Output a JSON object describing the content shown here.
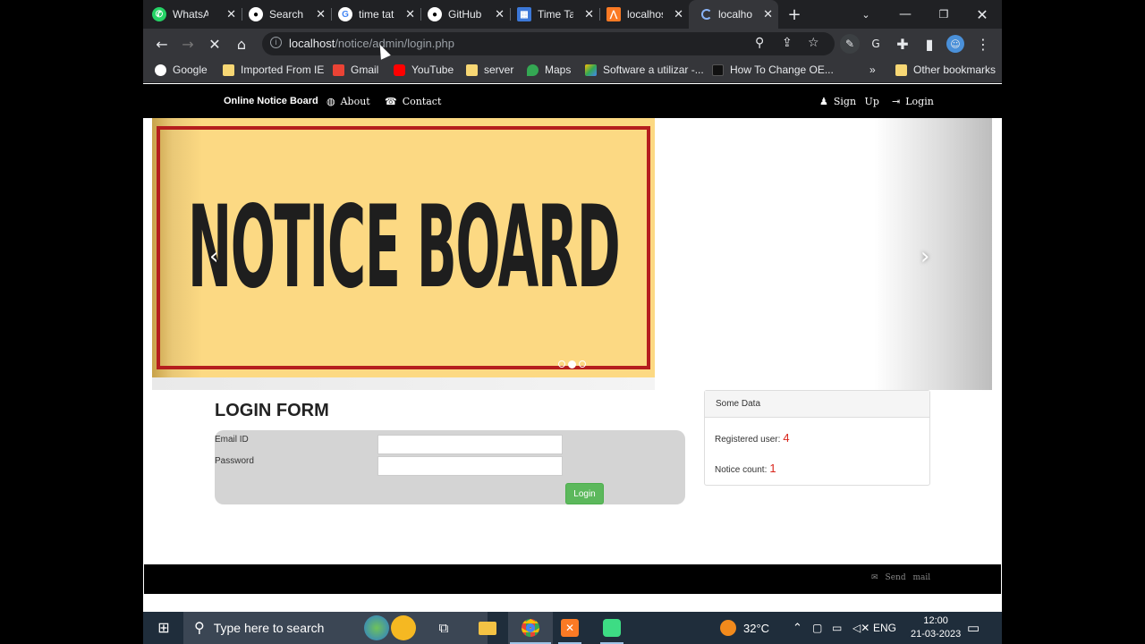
{
  "browser": {
    "tabs": [
      {
        "label": "WhatsA",
        "icon": "whatsapp-icon"
      },
      {
        "label": "Search ·",
        "icon": "github-icon"
      },
      {
        "label": "time tat",
        "icon": "google-icon"
      },
      {
        "label": "GitHub",
        "icon": "github-icon"
      },
      {
        "label": "Time Ta",
        "icon": "page-icon"
      },
      {
        "label": "localhos",
        "icon": "xampp-icon"
      },
      {
        "label": "localho",
        "icon": "loading-icon"
      }
    ],
    "url_host": "localhost",
    "url_path": "/notice/admin/login.php",
    "bookmarks": [
      {
        "label": "Google",
        "icon": "google-icon"
      },
      {
        "label": "Imported From IE",
        "icon": "folder-icon"
      },
      {
        "label": "Gmail",
        "icon": "gmail-icon"
      },
      {
        "label": "YouTube",
        "icon": "youtube-icon"
      },
      {
        "label": "server",
        "icon": "folder-icon"
      },
      {
        "label": "Maps",
        "icon": "maps-icon"
      },
      {
        "label": "Software a utilizar -...",
        "icon": "drive-icon"
      },
      {
        "label": "How To Change OE...",
        "icon": "page-icon"
      }
    ],
    "other_bookmarks": "Other bookmarks",
    "overflow": "»"
  },
  "site": {
    "brand": "Online Notice Board",
    "nav": {
      "about": "About",
      "contact": "Contact",
      "signup": "Sign Up",
      "login": "Login"
    },
    "banner_text": "NOTICE BOARD",
    "login_form": {
      "title": "LOGIN FORM",
      "email_label": "Email ID",
      "password_label": "Password",
      "email_value": "",
      "password_value": "",
      "submit": "Login"
    },
    "panel": {
      "title": "Some Data",
      "registered_label": "Registered user:",
      "registered_value": "4",
      "notice_label": "Notice count:",
      "notice_value": "1"
    },
    "footer_send": "Send mail"
  },
  "taskbar": {
    "search_placeholder": "Type here to search",
    "temperature": "32°C",
    "language": "ENG",
    "time": "12:00",
    "date": "21-03-2023"
  }
}
